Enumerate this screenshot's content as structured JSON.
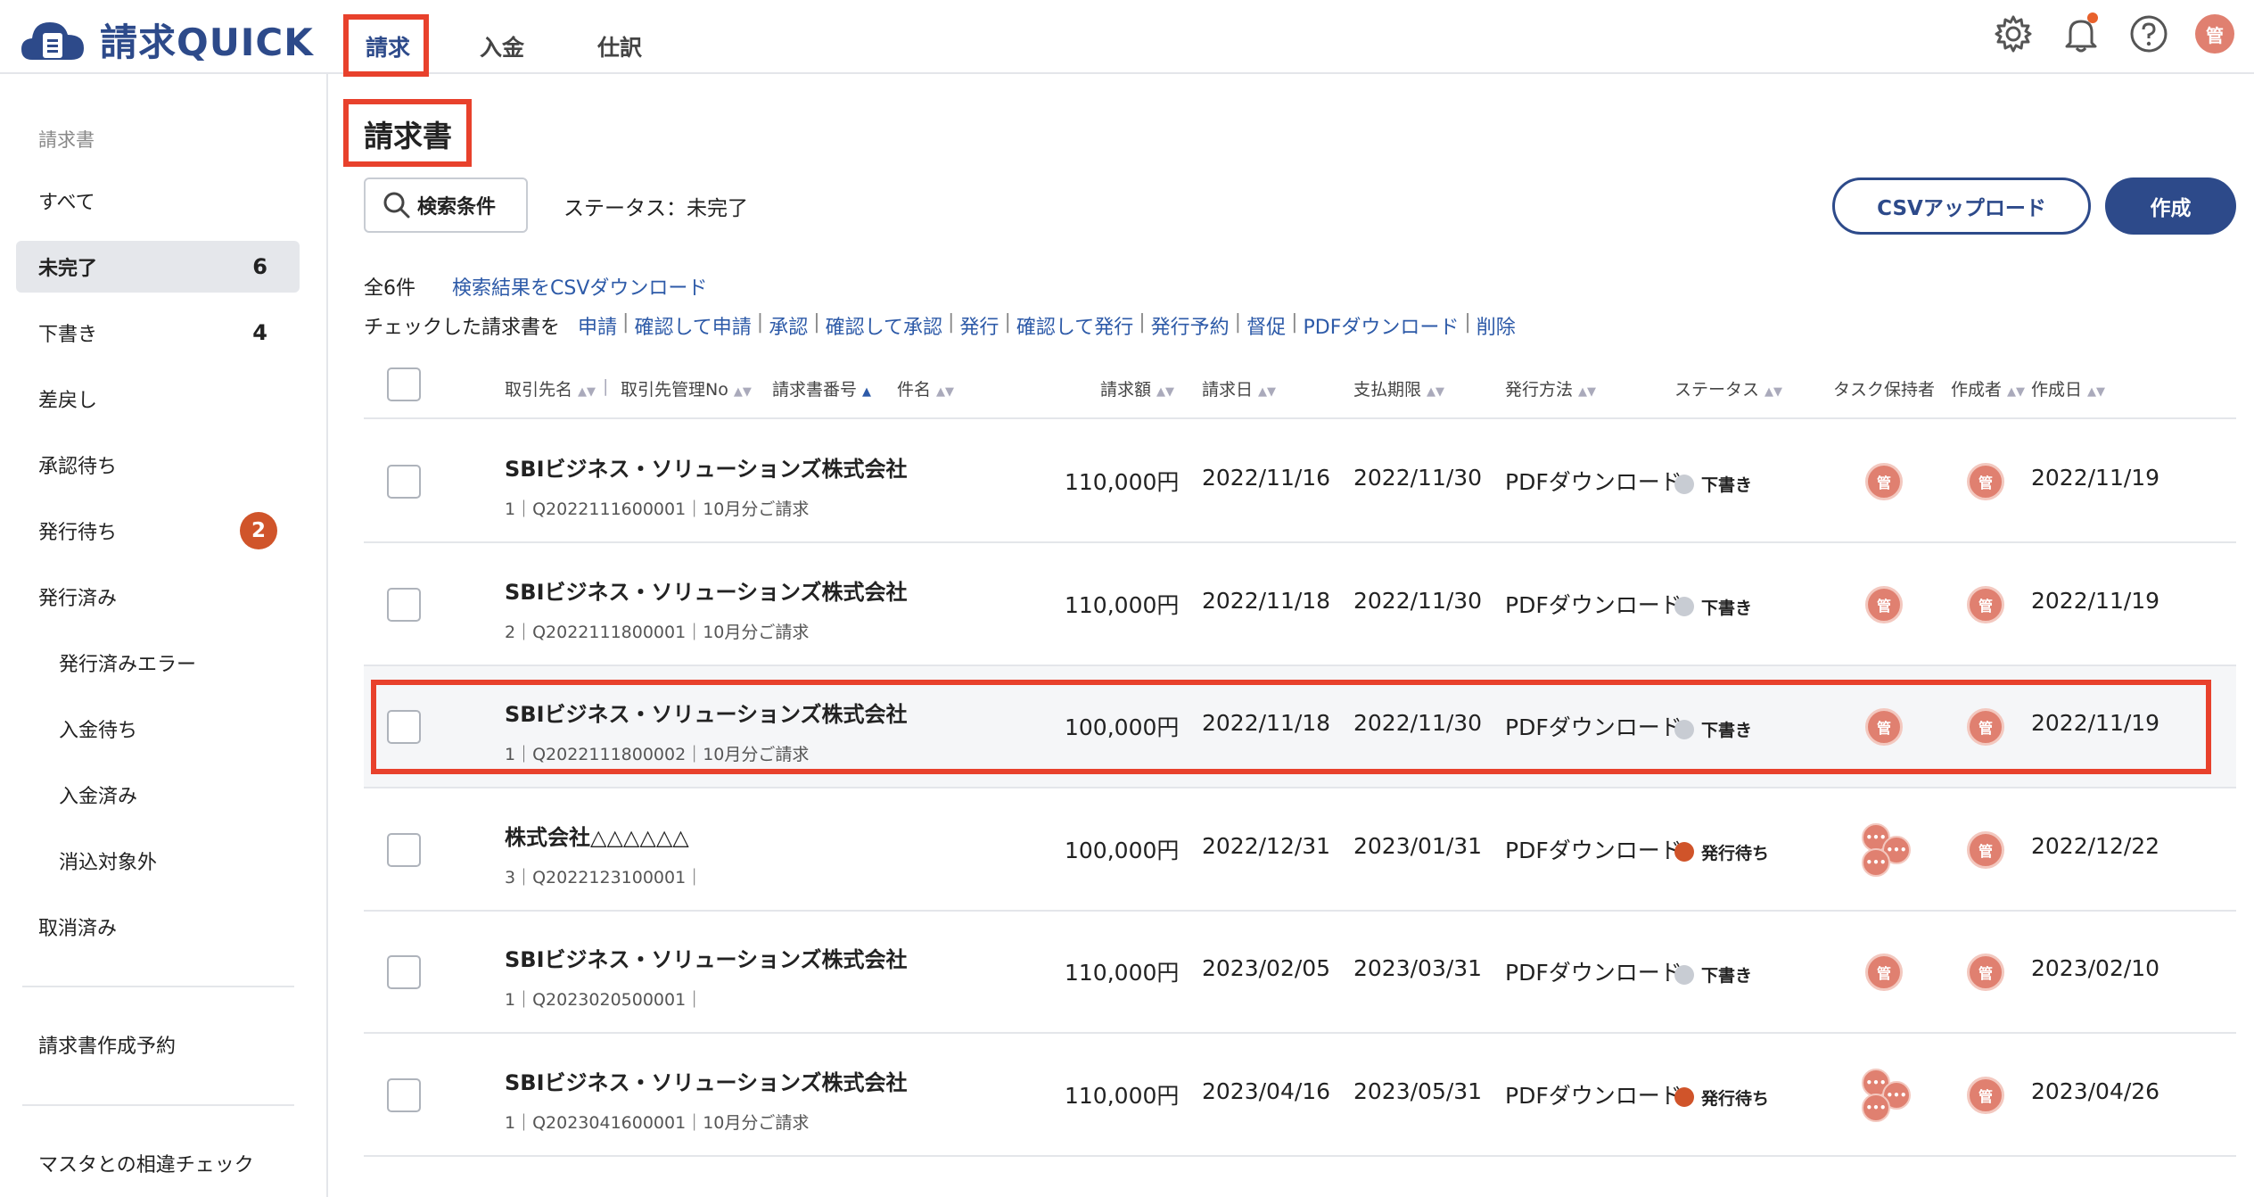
{
  "app": {
    "name": "請求QUICK"
  },
  "tabs": [
    {
      "label": "請求",
      "active": true
    },
    {
      "label": "入金",
      "active": false
    },
    {
      "label": "仕訳",
      "active": false
    }
  ],
  "header_icons": [
    "gear-icon",
    "bell-icon",
    "help-icon"
  ],
  "user_avatar": "管",
  "colors": {
    "brand": "#2d4a8a",
    "highlight": "#e8412c",
    "badge": "#d0542a",
    "avatar": "#e08070"
  },
  "sidebar": {
    "heading": "請求書",
    "items": [
      {
        "label": "すべて",
        "count": ""
      },
      {
        "label": "未完了",
        "count": "6"
      },
      {
        "label": "下書き",
        "count": "4"
      },
      {
        "label": "差戻し",
        "count": ""
      },
      {
        "label": "承認待ち",
        "count": ""
      },
      {
        "label": "発行待ち",
        "count": "2"
      },
      {
        "label": "発行済み",
        "count": ""
      },
      {
        "label": "発行済みエラー",
        "count": ""
      },
      {
        "label": "入金待ち",
        "count": ""
      },
      {
        "label": "入金済み",
        "count": ""
      },
      {
        "label": "消込対象外",
        "count": ""
      },
      {
        "label": "取消済み",
        "count": ""
      }
    ],
    "extra_1": "請求書作成予約",
    "extra_2": "マスタとの相違チェック"
  },
  "main": {
    "title": "請求書",
    "search_button": "検索条件",
    "status_filter": "ステータス：未完了",
    "csv_upload": "CSVアップロード",
    "create": "作成",
    "total": "全6件",
    "csv_download": "検索結果をCSVダウンロード",
    "bulk_lead": "チェックした請求書を",
    "bulk_actions": [
      "申請",
      "確認して申請",
      "承認",
      "確認して承認",
      "発行",
      "確認して発行",
      "発行予約",
      "督促",
      "PDFダウンロード",
      "削除"
    ]
  },
  "table": {
    "columns": [
      "取引先名",
      "取引先管理No",
      "請求書番号",
      "件名",
      "請求額",
      "請求日",
      "支払期限",
      "発行方法",
      "ステータス",
      "タスク保持者",
      "作成者",
      "作成日"
    ],
    "rows": [
      {
        "partner": "SBIビジネス・ソリューションズ株式会社",
        "meta": "1｜Q2022111600001｜10月分ご請求",
        "amount": "110,000円",
        "invoice_date": "2022/11/16",
        "due_date": "2022/11/30",
        "method": "PDFダウンロード",
        "status": "下書き",
        "status_color": "#c8ccd3",
        "task_holder": "管",
        "creator": "管",
        "created": "2022/11/19"
      },
      {
        "partner": "SBIビジネス・ソリューションズ株式会社",
        "meta": "2｜Q2022111800001｜10月分ご請求",
        "amount": "110,000円",
        "invoice_date": "2022/11/18",
        "due_date": "2022/11/30",
        "method": "PDFダウンロード",
        "status": "下書き",
        "status_color": "#c8ccd3",
        "task_holder": "管",
        "creator": "管",
        "created": "2022/11/19"
      },
      {
        "partner": "SBIビジネス・ソリューションズ株式会社",
        "meta": "1｜Q2022111800002｜10月分ご請求",
        "amount": "100,000円",
        "invoice_date": "2022/11/18",
        "due_date": "2022/11/30",
        "method": "PDFダウンロード",
        "status": "下書き",
        "status_color": "#c8ccd3",
        "task_holder": "管",
        "creator": "管",
        "created": "2022/11/19"
      },
      {
        "partner": "株式会社△△△△△△",
        "meta": "3｜Q2022123100001｜",
        "amount": "100,000円",
        "invoice_date": "2022/12/31",
        "due_date": "2023/01/31",
        "method": "PDFダウンロード",
        "status": "発行待ち",
        "status_color": "#d0542a",
        "task_holder": "•••",
        "creator": "管",
        "created": "2022/12/22"
      },
      {
        "partner": "SBIビジネス・ソリューションズ株式会社",
        "meta": "1｜Q2023020500001｜",
        "amount": "110,000円",
        "invoice_date": "2023/02/05",
        "due_date": "2023/03/31",
        "method": "PDFダウンロード",
        "status": "下書き",
        "status_color": "#c8ccd3",
        "task_holder": "管",
        "creator": "管",
        "created": "2023/02/10"
      },
      {
        "partner": "SBIビジネス・ソリューションズ株式会社",
        "meta": "1｜Q2023041600001｜10月分ご請求",
        "amount": "110,000円",
        "invoice_date": "2023/04/16",
        "due_date": "2023/05/31",
        "method": "PDFダウンロード",
        "status": "発行待ち",
        "status_color": "#d0542a",
        "task_holder": "•••",
        "creator": "管",
        "created": "2023/04/26"
      }
    ]
  }
}
